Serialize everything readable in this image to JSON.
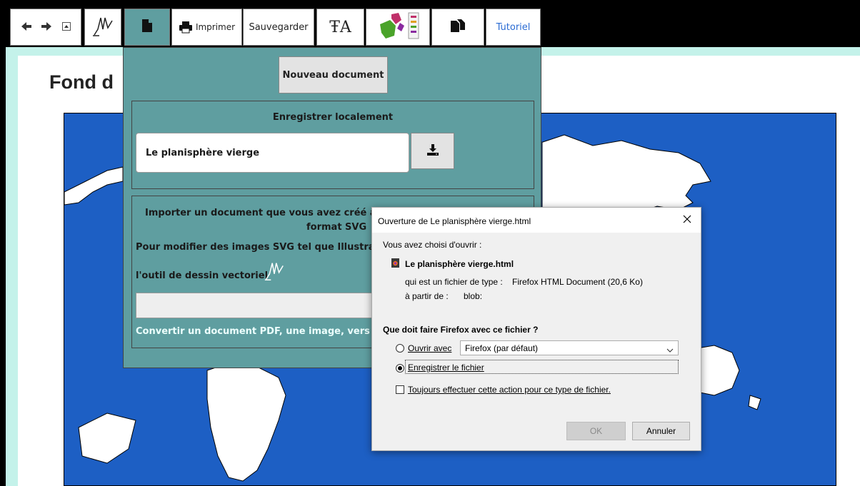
{
  "toolbar": {
    "back_icon": "arrow-left-icon",
    "forward_icon": "arrow-right-icon",
    "collapse_icon": "collapse-icon",
    "pen_icon": "hand-pen-icon",
    "document_icon": "document-icon",
    "print_label": "Imprimer",
    "save_label": "Sauvegarder",
    "text_tool_label": "ŦA",
    "map_icon": "map-legend-icon",
    "copy_icon": "copy-document-icon",
    "tutorial_label": "Tutoriel"
  },
  "page": {
    "title": "Fond d"
  },
  "menu": {
    "new_document_label": "Nouveau document",
    "save_locally_title": "Enregistrer localement",
    "filename_value": "Le planisphère vierge",
    "download_icon": "download-icon",
    "import_title_line1": "Importer un document que vous avez créé ave",
    "import_title_line2": "format SVG",
    "modify_text": "Pour modifier des images SVG tel que Illustrator",
    "vector_tool_text": "l'outil de dessin vectoriel",
    "convert_text": "Convertir un document PDF, une image, vers le"
  },
  "dialog": {
    "title": "Ouverture de Le planisphère vierge.html",
    "close_icon": "close-icon",
    "chosen_text": "Vous avez choisi d'ouvrir :",
    "file_icon": "html-file-icon",
    "file_name": "Le planisphère vierge.html",
    "type_label": "qui est un fichier de type :",
    "type_value": "Firefox HTML Document (20,6 Ko)",
    "from_label": "à partir de :",
    "from_value": "blob:",
    "question": "Que doit faire Firefox avec ce fichier ?",
    "open_with_label": "Ouvrir avec",
    "open_with_value": "Firefox (par défaut)",
    "save_file_label": "Enregistrer le fichier",
    "always_label": "Toujours effectuer cette action pour ce type de fichier.",
    "ok_label": "OK",
    "cancel_label": "Annuler"
  }
}
